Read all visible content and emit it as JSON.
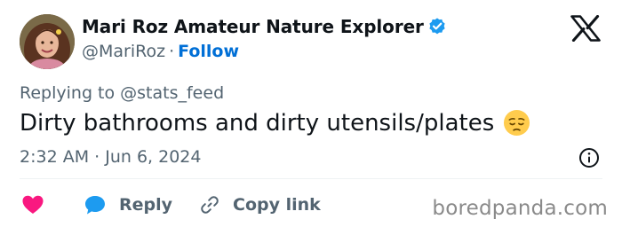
{
  "user": {
    "display_name": "Mari Roz Amateur Nature Explorer",
    "handle": "@MariRoz",
    "separator": "·",
    "follow_label": "Follow"
  },
  "tweet": {
    "reply_context": "Replying to @stats_feed",
    "text": "Dirty bathrooms and dirty utensils/plates",
    "timestamp": "2:32 AM · Jun 6, 2024"
  },
  "actions": {
    "reply_label": "Reply",
    "copy_link_label": "Copy link"
  },
  "icons": {
    "brand": "x-logo-icon",
    "verified": "verified-badge-icon",
    "emoji": "pensive-face-emoji-icon",
    "info": "info-icon",
    "like": "heart-icon",
    "reply": "speech-bubble-icon",
    "copy_link": "link-icon"
  },
  "colors": {
    "accent_blue": "#1d9bf0",
    "like_pink": "#f91880",
    "text_primary": "#0f1419",
    "text_secondary": "#536471"
  },
  "watermark": "boredpanda.com"
}
